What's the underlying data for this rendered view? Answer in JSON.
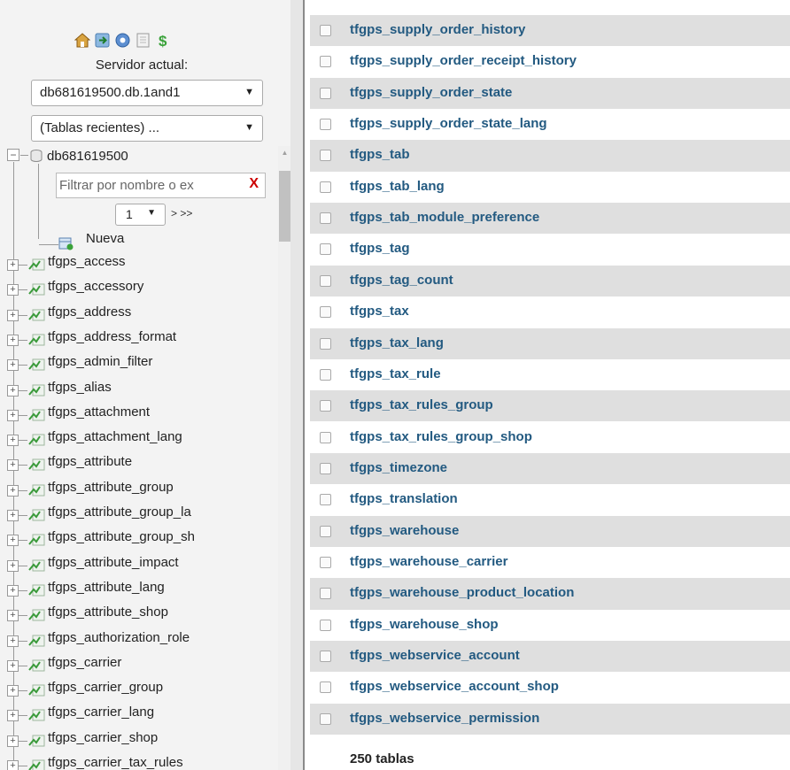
{
  "nav": {
    "icons": [
      "home-icon",
      "logout-icon",
      "help-icon",
      "docs-icon",
      "reload-icon"
    ],
    "server_label": "Servidor actual:",
    "server_value": "db681619500.db.1and1",
    "recent_tables": "(Tablas recientes) ...",
    "db_name": "db681619500",
    "filter_placeholder": "Filtrar por nombre o ex",
    "filter_clear": "X",
    "page_value": "1",
    "page_nav": "> >>",
    "new_label": "Nueva",
    "tables": [
      "tfgps_access",
      "tfgps_accessory",
      "tfgps_address",
      "tfgps_address_format",
      "tfgps_admin_filter",
      "tfgps_alias",
      "tfgps_attachment",
      "tfgps_attachment_lang",
      "tfgps_attribute",
      "tfgps_attribute_group",
      "tfgps_attribute_group_la",
      "tfgps_attribute_group_sh",
      "tfgps_attribute_impact",
      "tfgps_attribute_lang",
      "tfgps_attribute_shop",
      "tfgps_authorization_role",
      "tfgps_carrier",
      "tfgps_carrier_group",
      "tfgps_carrier_lang",
      "tfgps_carrier_shop",
      "tfgps_carrier_tax_rules"
    ]
  },
  "main": {
    "rows": [
      "tfgps_supply_order_history",
      "tfgps_supply_order_receipt_history",
      "tfgps_supply_order_state",
      "tfgps_supply_order_state_lang",
      "tfgps_tab",
      "tfgps_tab_lang",
      "tfgps_tab_module_preference",
      "tfgps_tag",
      "tfgps_tag_count",
      "tfgps_tax",
      "tfgps_tax_lang",
      "tfgps_tax_rule",
      "tfgps_tax_rules_group",
      "tfgps_tax_rules_group_shop",
      "tfgps_timezone",
      "tfgps_translation",
      "tfgps_warehouse",
      "tfgps_warehouse_carrier",
      "tfgps_warehouse_product_location",
      "tfgps_warehouse_shop",
      "tfgps_webservice_account",
      "tfgps_webservice_account_shop",
      "tfgps_webservice_permission"
    ],
    "footer": "250 tablas"
  },
  "colors": {
    "link": "#235a81",
    "row_alt": "#dfdfdf",
    "nav_bg": "#f3f3f3"
  }
}
